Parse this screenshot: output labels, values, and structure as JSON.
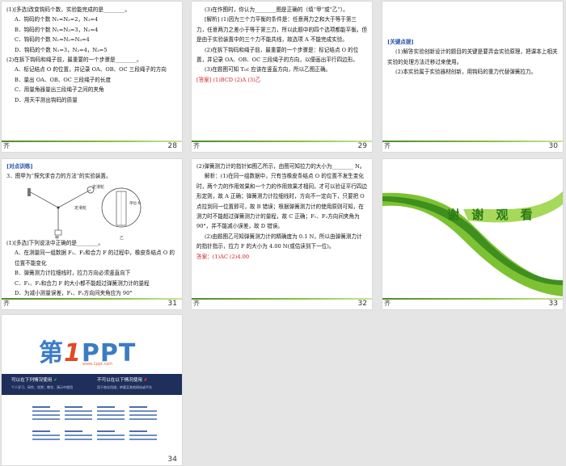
{
  "slides": [
    {
      "number": "28",
      "mark": "齐",
      "lines": [
        "(1)[多选]改变钩码个数，实验能完成的是________。",
        "A．钩码的个数 N₁=N₂=2，N₃=4",
        "B．钩码的个数 N₁=N₃=3，N₂=4",
        "C．钩码的个数 N₁=N₂=N₃=4",
        "D．钩码的个数 N₁=3，N₂=4，N₃=5",
        "(2)在拆下钩码和绳子前，最重要的一个步骤是________。",
        "A．标记结点 O 的位置，并记录 OA、OB、OC 三段绳子的方向",
        "B．量出 OA、OB、OC 三段绳子的长度",
        "C．用量角器量出三段绳子之间的夹角",
        "D．用天平测出钩码的质量"
      ]
    },
    {
      "number": "29",
      "mark": "齐",
      "lines": [
        "(3)在作图时，你认为________图是正确的（填“甲”或“乙”）。",
        "[解析] (1)因为三个力平衡的条件是：任意两力之和大于等于第三力，任意两力之差小于等于第三力，所以此题中的四个选项都能平衡。但是由于实验装置中的三个力不能共线，故选项 A 不能完成实验。",
        "(2)在拆下钩码和绳子前，最重要的一个步骤是：标记结点 O 的位置，并记录 OA、OB、OC 三段绳子的方向，以便画出平行四边形。",
        "(3)在题图可知 T₀c 应该在竖直方向，所以乙图正确。",
        "[答案] (1)BCD  (2)A  (3)乙"
      ]
    },
    {
      "number": "30",
      "mark": "齐",
      "lines": [
        "[关键点拨]",
        "(1)解答实验创新设计的题目的关键是要弄会实验原理，把课本上相关实验的处理方法迁移过来使用。",
        "(2)本实验属于实验器材创新，用钩码的重力代替弹簧拉力。"
      ]
    },
    {
      "number": "31",
      "mark": "齐",
      "lines": [
        "[对点训练]",
        "3．图甲为“探究求合力的方法”的实验装置。",
        "(1)[多选]下列说法中正确的是________。",
        "A．在测量同一组数据 F₁、F₂和合力 F 的过程中，橡皮条结点 O 的位置不能变化",
        "B．弹簧测力计拉细线时，拉力方向必须竖直向下",
        "C．F₁、F₂和合力 F 的大小都不能超过弹簧测力计的量程",
        "D．为减小测量误差，F₁、F₂方向间夹角应为 90°"
      ],
      "figure_labels": [
        "定滑轮",
        "定滑轮",
        "甲",
        "乙",
        "单位:N"
      ]
    },
    {
      "number": "32",
      "mark": "齐",
      "lines": [
        "(2)弹簧测力计的指针如图乙所示，由图可知拉力的大小为________ N。",
        "解析：(1)在同一组数据中，只有当橡皮条结点 O 的位置不发生变化时，两个力的作用效果和一个力的作用效果才相同，才可以验证平行四边形定则，故 A 正确；弹簧测力计拉细线时，方向不一定向下，只要把 O 点拉到同一位置即可，故 B 错误；根据弹簧测力计的使用原则可知，在测力时不能超过弹簧测力计的量程，故 C 正确；F₁、F₂方向间夹角为 90°，并不能减小误差，故 D 错误。",
        "(2)由题图乙可知弹簧测力计的精确度为 0.1 N，所以由弹簧测力计的指针指示，拉力 F 的大小为 4.00 N(或估读到下一位)。",
        "答案：(1)AC  (2)4.00"
      ]
    },
    {
      "number": "33",
      "mark": "齐",
      "thanks": "谢 谢 观 看"
    },
    {
      "number": "34",
      "logo_prefix": "第",
      "logo_one": "1",
      "logo_suffix": "PPT",
      "logo_url": "www.1ppt.com",
      "can_title": "可以在下列情况使用",
      "can_sub": "个人学习、研究、欣赏；教学、演示中使用",
      "cannot_title": "不可以在以下情况使用",
      "cannot_sub": "用于商业用途；转载至其他网站或平台"
    }
  ],
  "colors": {
    "stripe_left": "#4f8a2b",
    "stripe_mid": "#87c23e",
    "accent_green": "#2c7a14",
    "selection": "#2f7bd6"
  }
}
